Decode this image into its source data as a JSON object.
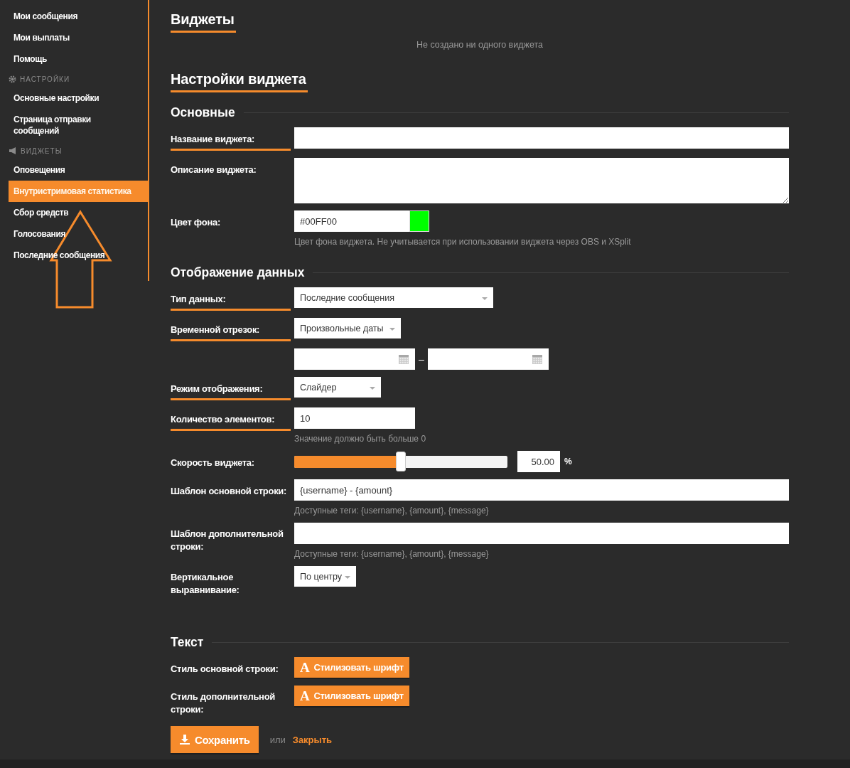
{
  "sidebar": {
    "items": [
      {
        "kind": "item",
        "label": "Мои сообщения",
        "selected": false
      },
      {
        "kind": "item",
        "label": "Мои выплаты",
        "selected": false
      },
      {
        "kind": "item",
        "label": "Помощь",
        "selected": false
      },
      {
        "kind": "section",
        "label": "НАСТРОЙКИ"
      },
      {
        "kind": "item",
        "label": "Основные настройки",
        "selected": false
      },
      {
        "kind": "item",
        "label": "Страница отправки сообщений",
        "selected": false
      },
      {
        "kind": "section",
        "label": "ВИДЖЕТЫ"
      },
      {
        "kind": "item",
        "label": "Оповещения",
        "selected": false
      },
      {
        "kind": "item",
        "label": "Внутристримовая статистика",
        "selected": true
      },
      {
        "kind": "item",
        "label": "Сбор средств",
        "selected": false
      },
      {
        "kind": "item",
        "label": "Голосования",
        "selected": false
      },
      {
        "kind": "item",
        "label": "Последние сообщения",
        "selected": false
      }
    ]
  },
  "widgets": {
    "title": "Виджеты",
    "underlined": true,
    "empty_text": "Не создано ни одного виджета"
  },
  "settings": {
    "title": "Настройки виджета",
    "underlined": true,
    "sections": [
      {
        "title": "Основные",
        "rows": [
          {
            "kind": "text",
            "label": "Название виджета:",
            "underlined": true
          },
          {
            "kind": "textarea",
            "label": "Описание виджета:",
            "underlined": false
          },
          {
            "kind": "color",
            "label": "Цвет фона:",
            "underlined": false,
            "value": "#00FF00",
            "color": "#00ff00",
            "hint": "Цвет фона виджета. Не учитывается при использовании виджета через OBS и XSplit"
          }
        ]
      },
      {
        "title": "Отображение данных",
        "rows": [
          {
            "kind": "select",
            "label": "Тип данных:",
            "underlined": true,
            "value": "Последние сообщения"
          },
          {
            "kind": "select",
            "label": "Временной отрезок:",
            "underlined": true,
            "value": "Произвольные даты"
          },
          {
            "kind": "daterange",
            "separator": "–"
          },
          {
            "kind": "select",
            "label": "Режим отображения:",
            "underlined": true,
            "value": "Слайдер"
          },
          {
            "kind": "text",
            "label": "Количество элементов:",
            "underlined": true,
            "value": "10",
            "hint": "Значение должно быть больше 0"
          },
          {
            "kind": "slider",
            "label": "Скорость виджета:",
            "underlined": false,
            "level": 0.5,
            "reading": "50.00",
            "unit": "%"
          },
          {
            "kind": "text",
            "label": "Шаблон основной строки:",
            "underlined": false,
            "value": "{username} - {amount}",
            "hint": "Доступные теги: {username}, {amount}, {message}"
          },
          {
            "kind": "text",
            "label": "Шаблон дополнительной строки:",
            "underlined": false,
            "hint": "Доступные теги: {username}, {amount}, {message}"
          },
          {
            "kind": "select",
            "label": "Вертикальное выравнивание:",
            "underlined": false,
            "value": "По центру"
          }
        ]
      },
      {
        "title": "Текст",
        "rows": [
          {
            "kind": "fontbutton",
            "label": "Стиль основной строки:",
            "underlined": false,
            "icon": "A",
            "button": "Стилизовать шрифт"
          },
          {
            "kind": "fontbutton",
            "label": "Стиль дополнительной строки:",
            "underlined": false,
            "icon": "A",
            "button": "Стилизовать шрифт"
          }
        ]
      }
    ],
    "save": "Сохранить",
    "or": "или",
    "close": "Закрыть"
  }
}
